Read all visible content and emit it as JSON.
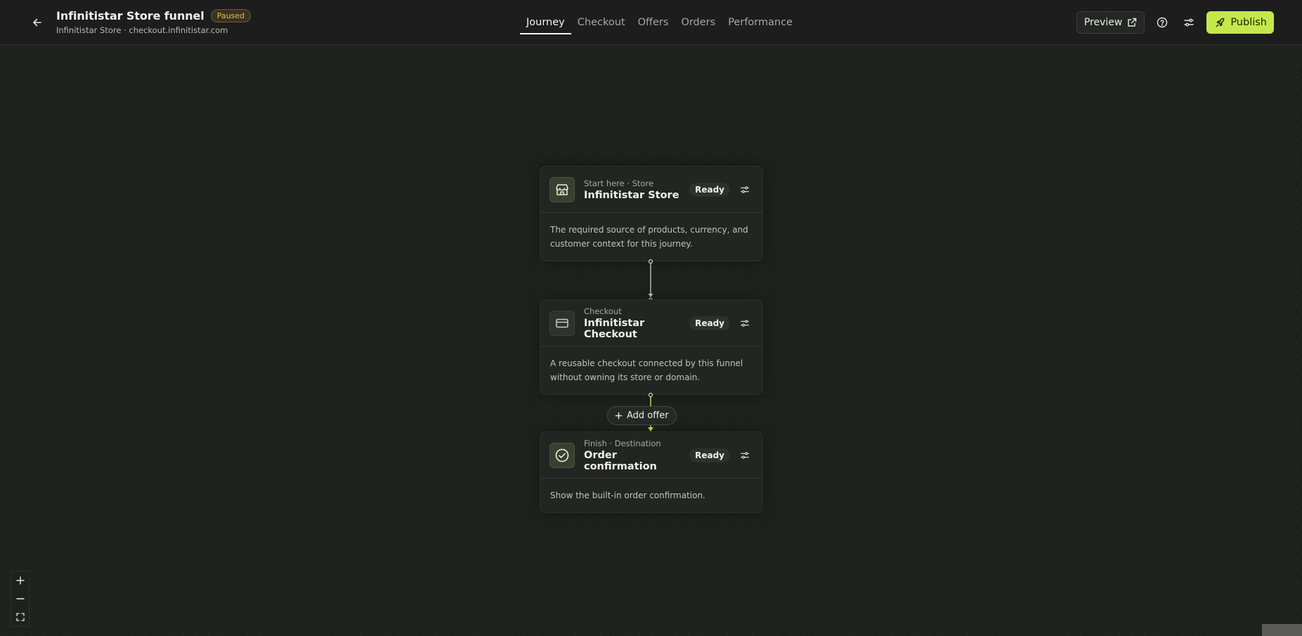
{
  "header": {
    "title": "Infinitistar Store funnel",
    "status": "Paused",
    "subtitle": "Infinitistar Store · checkout.infinitistar.com",
    "tabs": [
      {
        "label": "Journey",
        "active": true
      },
      {
        "label": "Checkout",
        "active": false
      },
      {
        "label": "Offers",
        "active": false
      },
      {
        "label": "Orders",
        "active": false
      },
      {
        "label": "Performance",
        "active": false
      }
    ],
    "preview_label": "Preview",
    "publish_label": "Publish"
  },
  "nodes": [
    {
      "kicker": "Start here · Store",
      "name": "Infinitistar Store",
      "status": "Ready",
      "description": "The required source of products, currency, and customer context for this journey.",
      "icon": "store-icon"
    },
    {
      "kicker": "Checkout",
      "name": "Infinitistar Checkout",
      "status": "Ready",
      "description": "A reusable checkout connected by this funnel without owning its store or domain.",
      "icon": "credit-card-icon"
    },
    {
      "kicker": "Finish · Destination",
      "name": "Order confirmation",
      "status": "Ready",
      "description": "Show the built-in order confirmation.",
      "icon": "check-circle-icon"
    }
  ],
  "add_offer_label": "Add offer",
  "colors": {
    "accent": "#c4e84b",
    "paused": "#e6b85c",
    "background": "#1f211f"
  }
}
